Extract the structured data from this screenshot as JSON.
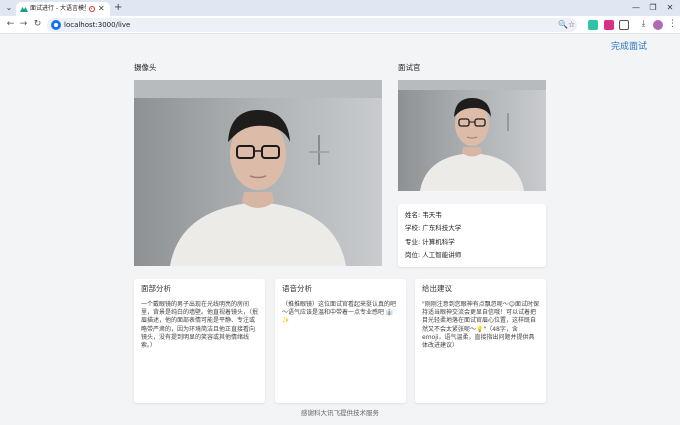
{
  "browser": {
    "tab_title": "面试进行 - 大语言模型多模",
    "url": "localhost:3000/live",
    "icons": {
      "tab_menu": "chevron-down-icon",
      "close_tab": "close-icon",
      "new_tab": "plus-icon",
      "back": "arrow-left-icon",
      "forward": "arrow-right-icon",
      "reload": "reload-icon",
      "zoom": "zoom-icon",
      "bookmark": "star-icon",
      "download": "download-icon",
      "menu": "kebab-menu-icon"
    },
    "glyphs": {
      "tab_menu": "⌄",
      "close": "✕",
      "new_tab": "+",
      "back": "←",
      "forward": "→",
      "reload": "↻",
      "zoom": "🔍",
      "star": "☆",
      "download": "⤓",
      "menu": "⋮",
      "minimize": "—",
      "maximize": "❐",
      "window_close": "✕"
    }
  },
  "header": {
    "finish_label": "完成面试"
  },
  "camera": {
    "label": "摄像头"
  },
  "interviewer": {
    "label": "面试官",
    "info": [
      {
        "key": "姓名",
        "value": "韦天韦"
      },
      {
        "key": "学校",
        "value": "广东科技大学"
      },
      {
        "key": "专业",
        "value": "计算机科学"
      },
      {
        "key": "岗位",
        "value": "人工智能讲师"
      }
    ],
    "lines": [
      "姓名: 韦天韦",
      "学校: 广东科技大学",
      "专业: 计算机科学",
      "岗位: 人工智能讲师"
    ]
  },
  "panels": [
    {
      "title": "面部分析",
      "body": "一个戴眼镜的男子出现在光线明亮的房间里，背景是纯白的墙壁。他直视着镜头，（抿眉描述，他的面部表情可能是平静、专注或略带严肃的，因为环境简洁且他正直接看向镜头，没有提到明显的笑容或其他情绪线索。）"
    },
    {
      "title": "语音分析",
      "body": "（推推眼镜）这位面试官看起来挺认真的吧～语气应该是温和中带着一点专业感吧 👔✨"
    },
    {
      "title": "给出建议",
      "body": "\"刚刚注意到您眼神有点飘忽呢～😊面试时保持适当眼神交流会更显自信哦！可以试着把目光轻柔地落在面试官眉心位置，这样既自然又不会太紧张呢～💡\"（48字，含emoji，语气温柔，直接指出问题并提供具体改进建议）"
    }
  ],
  "footer": {
    "text": "感谢科大讯飞提供技术服务"
  },
  "colors": {
    "accent": "#2b73c0",
    "background": "#f3f4f6",
    "recording": "#d93025"
  }
}
